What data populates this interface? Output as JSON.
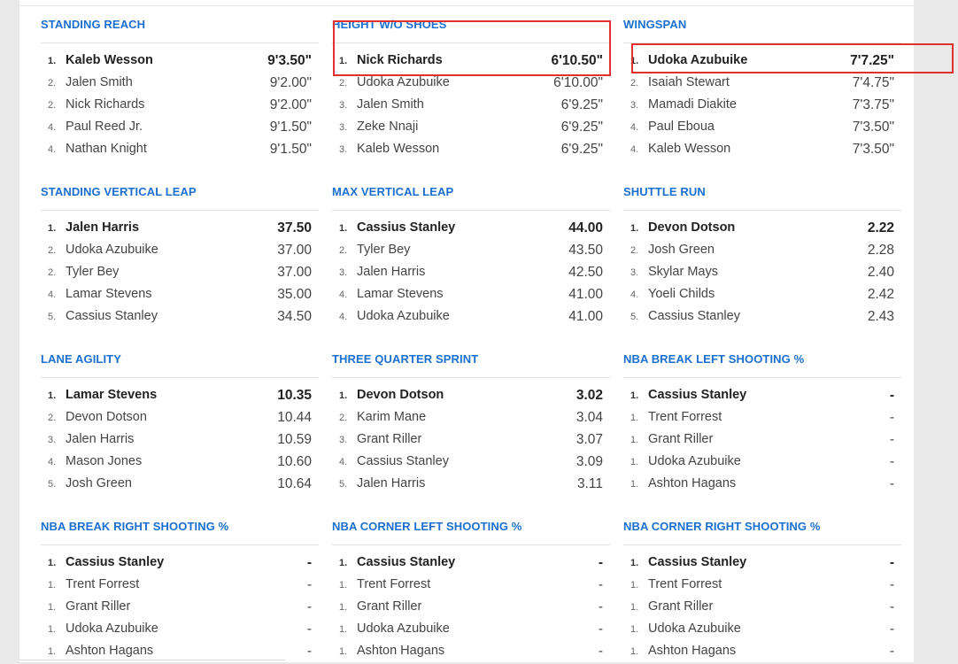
{
  "panels": [
    {
      "title": "STANDING REACH",
      "rows": [
        {
          "rank": "1.",
          "name": "Kaleb Wesson",
          "value": "9'3.50\""
        },
        {
          "rank": "2.",
          "name": "Jalen Smith",
          "value": "9'2.00\""
        },
        {
          "rank": "2.",
          "name": "Nick Richards",
          "value": "9'2.00\""
        },
        {
          "rank": "4.",
          "name": "Paul Reed Jr.",
          "value": "9'1.50\""
        },
        {
          "rank": "4.",
          "name": "Nathan Knight",
          "value": "9'1.50\""
        }
      ]
    },
    {
      "title": "HEIGHT W/O SHOES",
      "rows": [
        {
          "rank": "1.",
          "name": "Nick Richards",
          "value": "6'10.50\""
        },
        {
          "rank": "2.",
          "name": "Udoka Azubuike",
          "value": "6'10.00\""
        },
        {
          "rank": "3.",
          "name": "Jalen Smith",
          "value": "6'9.25\""
        },
        {
          "rank": "3.",
          "name": "Zeke Nnaji",
          "value": "6'9.25\""
        },
        {
          "rank": "3.",
          "name": "Kaleb Wesson",
          "value": "6'9.25\""
        }
      ]
    },
    {
      "title": "WINGSPAN",
      "rows": [
        {
          "rank": "1.",
          "name": "Udoka Azubuike",
          "value": "7'7.25\""
        },
        {
          "rank": "2.",
          "name": "Isaiah Stewart",
          "value": "7'4.75\""
        },
        {
          "rank": "3.",
          "name": "Mamadi Diakite",
          "value": "7'3.75\""
        },
        {
          "rank": "4.",
          "name": "Paul Eboua",
          "value": "7'3.50\""
        },
        {
          "rank": "4.",
          "name": "Kaleb Wesson",
          "value": "7'3.50\""
        }
      ]
    },
    {
      "title": "STANDING VERTICAL LEAP",
      "rows": [
        {
          "rank": "1.",
          "name": "Jalen Harris",
          "value": "37.50"
        },
        {
          "rank": "2.",
          "name": "Udoka Azubuike",
          "value": "37.00"
        },
        {
          "rank": "2.",
          "name": "Tyler Bey",
          "value": "37.00"
        },
        {
          "rank": "4.",
          "name": "Lamar Stevens",
          "value": "35.00"
        },
        {
          "rank": "5.",
          "name": "Cassius Stanley",
          "value": "34.50"
        }
      ]
    },
    {
      "title": "MAX VERTICAL LEAP",
      "rows": [
        {
          "rank": "1.",
          "name": "Cassius Stanley",
          "value": "44.00"
        },
        {
          "rank": "2.",
          "name": "Tyler Bey",
          "value": "43.50"
        },
        {
          "rank": "3.",
          "name": "Jalen Harris",
          "value": "42.50"
        },
        {
          "rank": "4.",
          "name": "Lamar Stevens",
          "value": "41.00"
        },
        {
          "rank": "4.",
          "name": "Udoka Azubuike",
          "value": "41.00"
        }
      ]
    },
    {
      "title": "SHUTTLE RUN",
      "rows": [
        {
          "rank": "1.",
          "name": "Devon Dotson",
          "value": "2.22"
        },
        {
          "rank": "2.",
          "name": "Josh Green",
          "value": "2.28"
        },
        {
          "rank": "3.",
          "name": "Skylar Mays",
          "value": "2.40"
        },
        {
          "rank": "4.",
          "name": "Yoeli Childs",
          "value": "2.42"
        },
        {
          "rank": "5.",
          "name": "Cassius Stanley",
          "value": "2.43"
        }
      ]
    },
    {
      "title": "LANE AGILITY",
      "rows": [
        {
          "rank": "1.",
          "name": "Lamar Stevens",
          "value": "10.35"
        },
        {
          "rank": "2.",
          "name": "Devon Dotson",
          "value": "10.44"
        },
        {
          "rank": "3.",
          "name": "Jalen Harris",
          "value": "10.59"
        },
        {
          "rank": "4.",
          "name": "Mason Jones",
          "value": "10.60"
        },
        {
          "rank": "5.",
          "name": "Josh Green",
          "value": "10.64"
        }
      ]
    },
    {
      "title": "THREE QUARTER SPRINT",
      "rows": [
        {
          "rank": "1.",
          "name": "Devon Dotson",
          "value": "3.02"
        },
        {
          "rank": "2.",
          "name": "Karim Mane",
          "value": "3.04"
        },
        {
          "rank": "3.",
          "name": "Grant Riller",
          "value": "3.07"
        },
        {
          "rank": "4.",
          "name": "Cassius Stanley",
          "value": "3.09"
        },
        {
          "rank": "5.",
          "name": "Jalen Harris",
          "value": "3.11"
        }
      ]
    },
    {
      "title": "NBA BREAK LEFT SHOOTING %",
      "rows": [
        {
          "rank": "1.",
          "name": "Cassius Stanley",
          "value": "-"
        },
        {
          "rank": "1.",
          "name": "Trent Forrest",
          "value": "-"
        },
        {
          "rank": "1.",
          "name": "Grant Riller",
          "value": "-"
        },
        {
          "rank": "1.",
          "name": "Udoka Azubuike",
          "value": "-"
        },
        {
          "rank": "1.",
          "name": "Ashton Hagans",
          "value": "-"
        }
      ]
    },
    {
      "title": "NBA BREAK RIGHT SHOOTING %",
      "rows": [
        {
          "rank": "1.",
          "name": "Cassius Stanley",
          "value": "-"
        },
        {
          "rank": "1.",
          "name": "Trent Forrest",
          "value": "-"
        },
        {
          "rank": "1.",
          "name": "Grant Riller",
          "value": "-"
        },
        {
          "rank": "1.",
          "name": "Udoka Azubuike",
          "value": "-"
        },
        {
          "rank": "1.",
          "name": "Ashton Hagans",
          "value": "-"
        }
      ]
    },
    {
      "title": "NBA CORNER LEFT SHOOTING %",
      "rows": [
        {
          "rank": "1.",
          "name": "Cassius Stanley",
          "value": "-"
        },
        {
          "rank": "1.",
          "name": "Trent Forrest",
          "value": "-"
        },
        {
          "rank": "1.",
          "name": "Grant Riller",
          "value": "-"
        },
        {
          "rank": "1.",
          "name": "Udoka Azubuike",
          "value": "-"
        },
        {
          "rank": "1.",
          "name": "Ashton Hagans",
          "value": "-"
        }
      ]
    },
    {
      "title": "NBA CORNER RIGHT SHOOTING %",
      "rows": [
        {
          "rank": "1.",
          "name": "Cassius Stanley",
          "value": "-"
        },
        {
          "rank": "1.",
          "name": "Trent Forrest",
          "value": "-"
        },
        {
          "rank": "1.",
          "name": "Grant Riller",
          "value": "-"
        },
        {
          "rank": "1.",
          "name": "Udoka Azubuike",
          "value": "-"
        },
        {
          "rank": "1.",
          "name": "Ashton Hagans",
          "value": "-"
        }
      ]
    }
  ],
  "colors": {
    "title": "#1a6fd0",
    "highlight": "#e03131"
  }
}
